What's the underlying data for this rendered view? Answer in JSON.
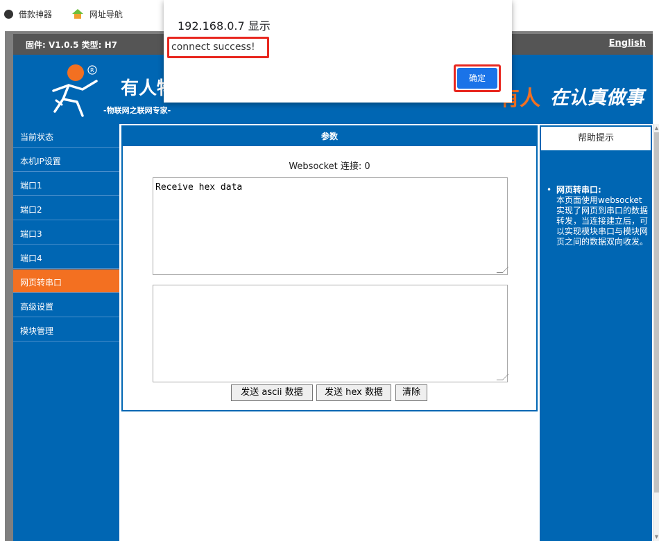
{
  "bookmarks": [
    {
      "label": "借款神器",
      "icon": "globe-icon"
    },
    {
      "label": "网址导航",
      "icon": "house-icon"
    }
  ],
  "firmware": {
    "text": "固件: V1.0.5 类型: H7",
    "language_link": "English"
  },
  "banner": {
    "brand_title": "有人物",
    "brand_subtitle": "-物联网之联网专家-",
    "slogan_orange": "有人",
    "slogan_white": "在认真做事"
  },
  "sidebar": {
    "items": [
      {
        "label": "当前状态",
        "active": false
      },
      {
        "label": "本机IP设置",
        "active": false
      },
      {
        "label": "端口1",
        "active": false
      },
      {
        "label": "端口2",
        "active": false
      },
      {
        "label": "端口3",
        "active": false
      },
      {
        "label": "端口4",
        "active": false
      },
      {
        "label": "网页转串口",
        "active": true
      },
      {
        "label": "高级设置",
        "active": false
      },
      {
        "label": "模块管理",
        "active": false
      }
    ]
  },
  "panel": {
    "header": "参数",
    "ws_status": "Websocket 连接: 0",
    "receive_text": "Receive hex data",
    "send_text": "",
    "buttons": {
      "send_ascii": "发送 ascii 数据",
      "send_hex": "发送 hex 数据",
      "clear": "清除"
    }
  },
  "help": {
    "header": "帮助提示",
    "item_title": "网页转串口:",
    "item_body": "本页面使用websocket实现了网页到串口的数据转发，当连接建立后，可以实现模块串口与模块网页之间的数据双向收发。"
  },
  "dialog": {
    "title": "192.168.0.7 显示",
    "message": "connect success!",
    "ok_label": "确定"
  },
  "colors": {
    "brand_blue": "#0066b3",
    "active_orange": "#f37021",
    "highlight_red": "#e8271f",
    "dialog_button_blue": "#1a73e8"
  }
}
